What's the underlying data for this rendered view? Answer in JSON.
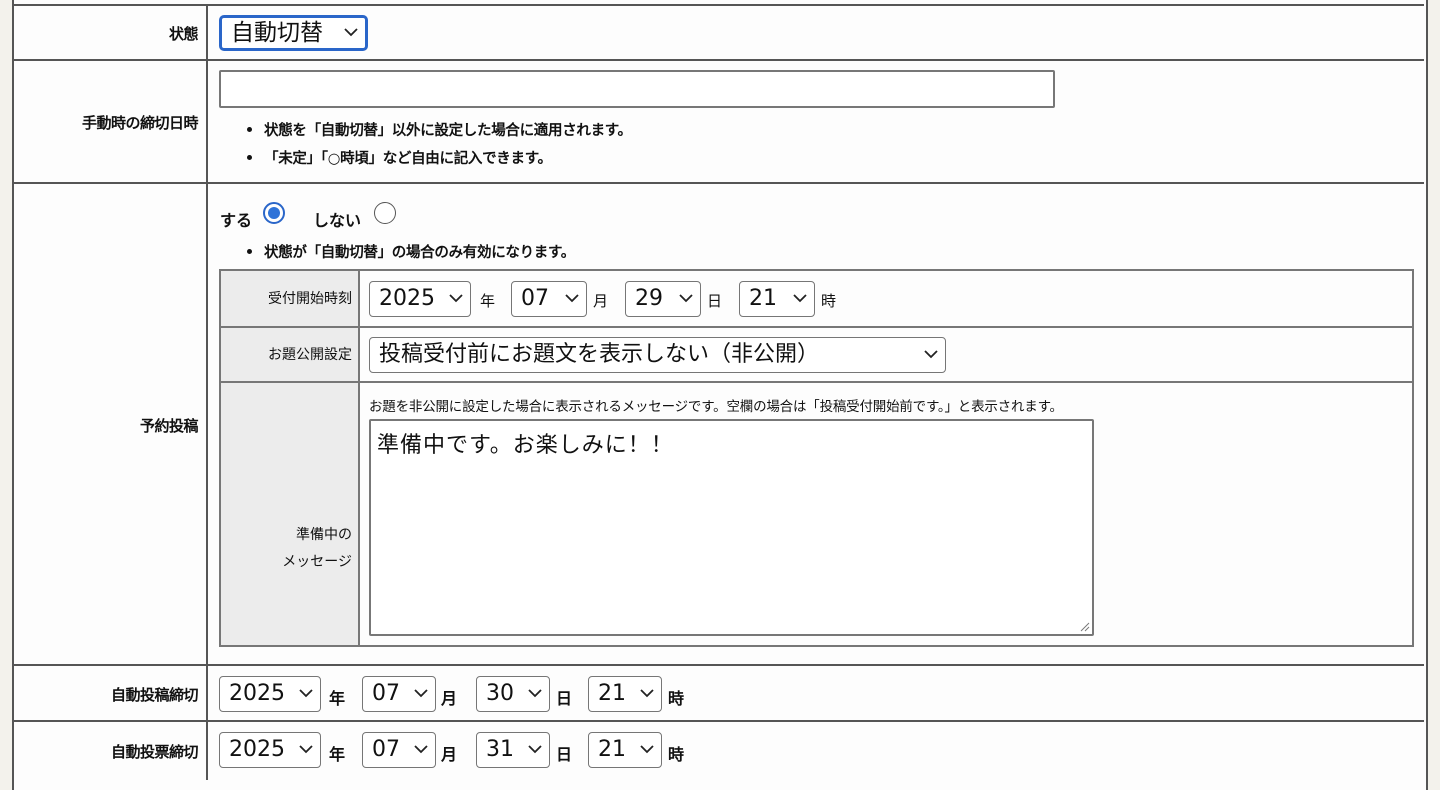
{
  "status": {
    "label": "状態",
    "value": "自動切替"
  },
  "manual_deadline": {
    "label": "手動時の締切日時",
    "value": "",
    "notes": [
      "状態を「自動切替」以外に設定した場合に適用されます。",
      "「未定」「○時頃」など自由に記入できます。"
    ]
  },
  "scheduled": {
    "label": "予約投稿",
    "options": [
      {
        "label": "する",
        "selected": true
      },
      {
        "label": "しない",
        "selected": false
      }
    ],
    "note": "状態が「自動切替」の場合のみ有効になります。",
    "start": {
      "label": "受付開始時刻",
      "year": "2025",
      "year_unit": "年",
      "month": "07",
      "month_unit": "月",
      "day": "29",
      "day_unit": "日",
      "hour": "21",
      "hour_unit": "時"
    },
    "visibility": {
      "label": "お題公開設定",
      "value": "投稿受付前にお題文を表示しない（非公開）"
    },
    "message": {
      "label_line1": "準備中の",
      "label_line2": "メッセージ",
      "help": "お題を非公開に設定した場合に表示されるメッセージです。空欄の場合は「投稿受付開始前です。」と表示されます。",
      "value": "準備中です。お楽しみに！！"
    }
  },
  "auto_post_deadline": {
    "label": "自動投稿締切",
    "year": "2025",
    "year_unit": "年",
    "month": "07",
    "month_unit": "月",
    "day": "30",
    "day_unit": "日",
    "hour": "21",
    "hour_unit": "時"
  },
  "auto_vote_deadline": {
    "label": "自動投票締切",
    "year": "2025",
    "year_unit": "年",
    "month": "07",
    "month_unit": "月",
    "day": "31",
    "day_unit": "日",
    "hour": "21",
    "hour_unit": "時"
  },
  "colors": {
    "focus": "#2a66c9",
    "border": "#555555",
    "label_bg": "#ececec"
  },
  "icons": {
    "select_arrow": "chevron-down-icon",
    "resize": "resize-grip-icon"
  }
}
